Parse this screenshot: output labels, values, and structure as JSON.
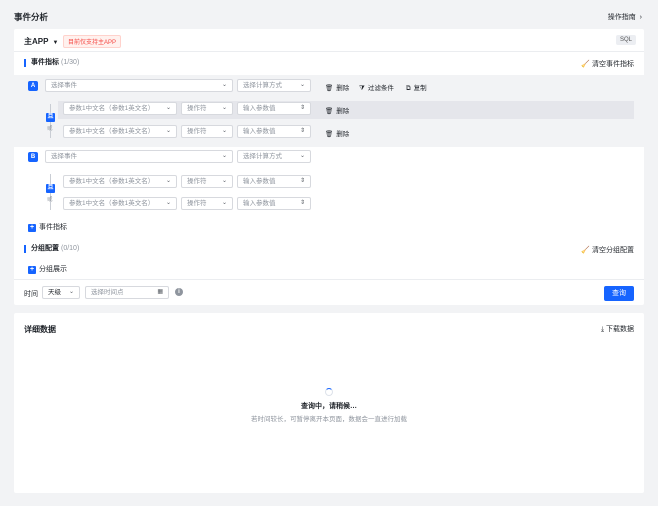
{
  "page": {
    "title": "事件分析",
    "guide_label": "操作指南",
    "guide_icon": "chevron-right-icon"
  },
  "app_bar": {
    "app_name": "主APP",
    "notice": "目前仅支持主APP",
    "sql_label": "SQL"
  },
  "event_metrics": {
    "title": "事件指标",
    "count": "(1/30)",
    "clear_label": "清空事件指标",
    "metrics": [
      {
        "badge": "A",
        "event_placeholder": "选择事件",
        "calc_placeholder": "选择计算方式",
        "delete_label": "删除",
        "filter_label": "过滤条件",
        "copy_label": "复制",
        "and_label": "且",
        "or_label": "或",
        "conditions": [
          {
            "param_placeholder": "参数1中文名（参数1英文名）",
            "op_placeholder": "操作符",
            "value_placeholder": "输入参数值",
            "delete_label": "删除"
          },
          {
            "param_placeholder": "参数1中文名（参数1英文名）",
            "op_placeholder": "操作符",
            "value_placeholder": "输入参数值",
            "delete_label": "删除"
          }
        ]
      },
      {
        "badge": "B",
        "event_placeholder": "选择事件",
        "calc_placeholder": "选择计算方式",
        "and_label": "且",
        "or_label": "或",
        "conditions": [
          {
            "param_placeholder": "参数1中文名（参数1英文名）",
            "op_placeholder": "操作符",
            "value_placeholder": "输入参数值"
          },
          {
            "param_placeholder": "参数1中文名（参数1英文名）",
            "op_placeholder": "操作符",
            "value_placeholder": "输入参数值"
          }
        ]
      }
    ],
    "add_label": "事件指标"
  },
  "group_config": {
    "title": "分组配置",
    "count": "(0/10)",
    "clear_label": "清空分组配置",
    "add_label": "分组展示"
  },
  "time_bar": {
    "label": "时间",
    "granularity": "天级",
    "date_placeholder": "选择时间点",
    "query_label": "查询"
  },
  "detail": {
    "title": "详细数据",
    "download_label": "下载数据",
    "loading_title": "查询中，请稍候…",
    "loading_hint": "若时间较长，可暂停离开本页面，数据会一直进行加载"
  }
}
